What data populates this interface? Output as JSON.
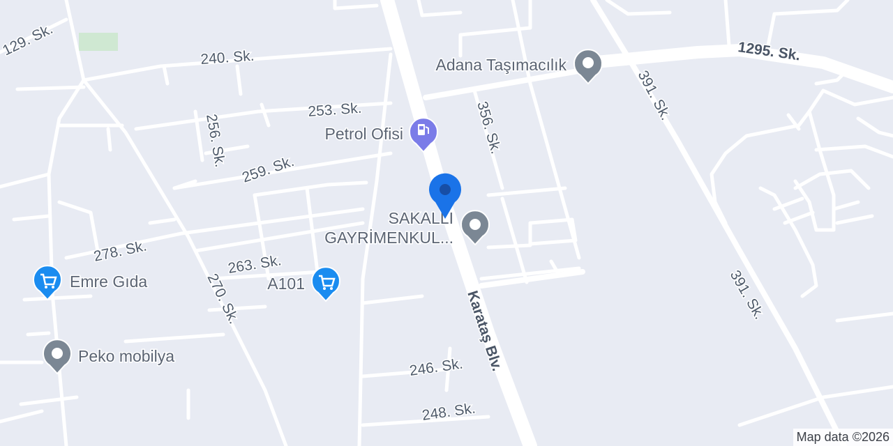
{
  "streets": {
    "s129": "129. Sk.",
    "s240": "240. Sk.",
    "s1295": "1295. Sk.",
    "s253": "253. Sk.",
    "s356": "356. Sk.",
    "s391a": "391. Sk.",
    "s391b": "391. Sk.",
    "s256": "256. Sk.",
    "s259": "259. Sk.",
    "s278": "278. Sk.",
    "s263": "263. Sk.",
    "s270": "270. Sk.",
    "karatas": "Karataş Blv.",
    "s246": "246. Sk.",
    "s248": "248. Sk."
  },
  "pois": {
    "adana": "Adana Taşımacılık",
    "petrol": "Petrol Ofisi",
    "sakalli_line1": "SAKALLI",
    "sakalli_line2": "GAYRİMENKUL...",
    "emre": "Emre Gıda",
    "a101": "A101",
    "peko": "Peko mobilya"
  },
  "attribution": "Map data ©2026",
  "colors": {
    "background": "#e8ebf3",
    "road": "#ffffff",
    "park": "#cfe8d2",
    "selected_pin": "#1a73e8",
    "shop_pin": "#1a8cf0",
    "fuel_pin": "#7b7ce8",
    "generic_pin": "#7b8794"
  }
}
